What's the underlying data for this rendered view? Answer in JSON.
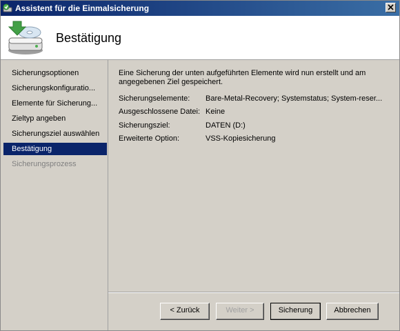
{
  "window": {
    "title": "Assistent für die Einmalsicherung",
    "close_glyph": "close-icon"
  },
  "header": {
    "title": "Bestätigung",
    "icon": "backup-drive-icon"
  },
  "sidebar": {
    "items": [
      {
        "label": "Sicherungsoptionen",
        "state": "normal"
      },
      {
        "label": "Sicherungskonfiguratio...",
        "state": "normal"
      },
      {
        "label": "Elemente für Sicherung...",
        "state": "normal"
      },
      {
        "label": "Zieltyp angeben",
        "state": "normal"
      },
      {
        "label": "Sicherungsziel auswählen",
        "state": "normal"
      },
      {
        "label": "Bestätigung",
        "state": "selected"
      },
      {
        "label": "Sicherungsprozess",
        "state": "disabled"
      }
    ]
  },
  "main": {
    "intro": "Eine Sicherung der unten aufgeführten Elemente wird nun erstellt und am angegebenen Ziel gespeichert.",
    "details": [
      {
        "label": "Sicherungselemente:",
        "value": "Bare-Metal-Recovery; Systemstatus; System-reser..."
      },
      {
        "label": "Ausgeschlossene Datei:",
        "value": "Keine"
      },
      {
        "label": "Sicherungsziel:",
        "value": "DATEN (D:)"
      },
      {
        "label": "Erweiterte Option:",
        "value": "VSS-Kopiesicherung"
      }
    ]
  },
  "buttons": {
    "back": "< Zurück",
    "next": "Weiter >",
    "backup": "Sicherung",
    "cancel": "Abbrechen"
  },
  "colors": {
    "titlebar_start": "#0a246a",
    "titlebar_end": "#3a6ea5",
    "selection": "#0a246a",
    "face": "#d4d0c8"
  }
}
